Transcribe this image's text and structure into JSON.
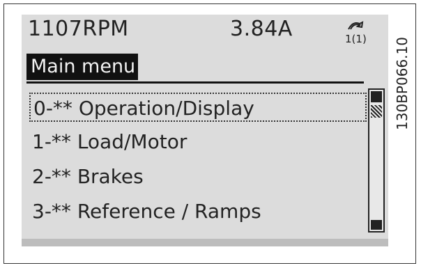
{
  "status": {
    "speed": "1107RPM",
    "current": "3.84A",
    "setup_indicator": "1(1)",
    "setup_icon": "hand-icon"
  },
  "menu": {
    "title": "Main menu",
    "items": [
      {
        "label": "0-** Operation/Display",
        "selected": true
      },
      {
        "label": "1-** Load/Motor",
        "selected": false
      },
      {
        "label": "2-** Brakes",
        "selected": false
      },
      {
        "label": "3-** Reference / Ramps",
        "selected": false
      }
    ]
  },
  "figure_id": "130BP066.10"
}
